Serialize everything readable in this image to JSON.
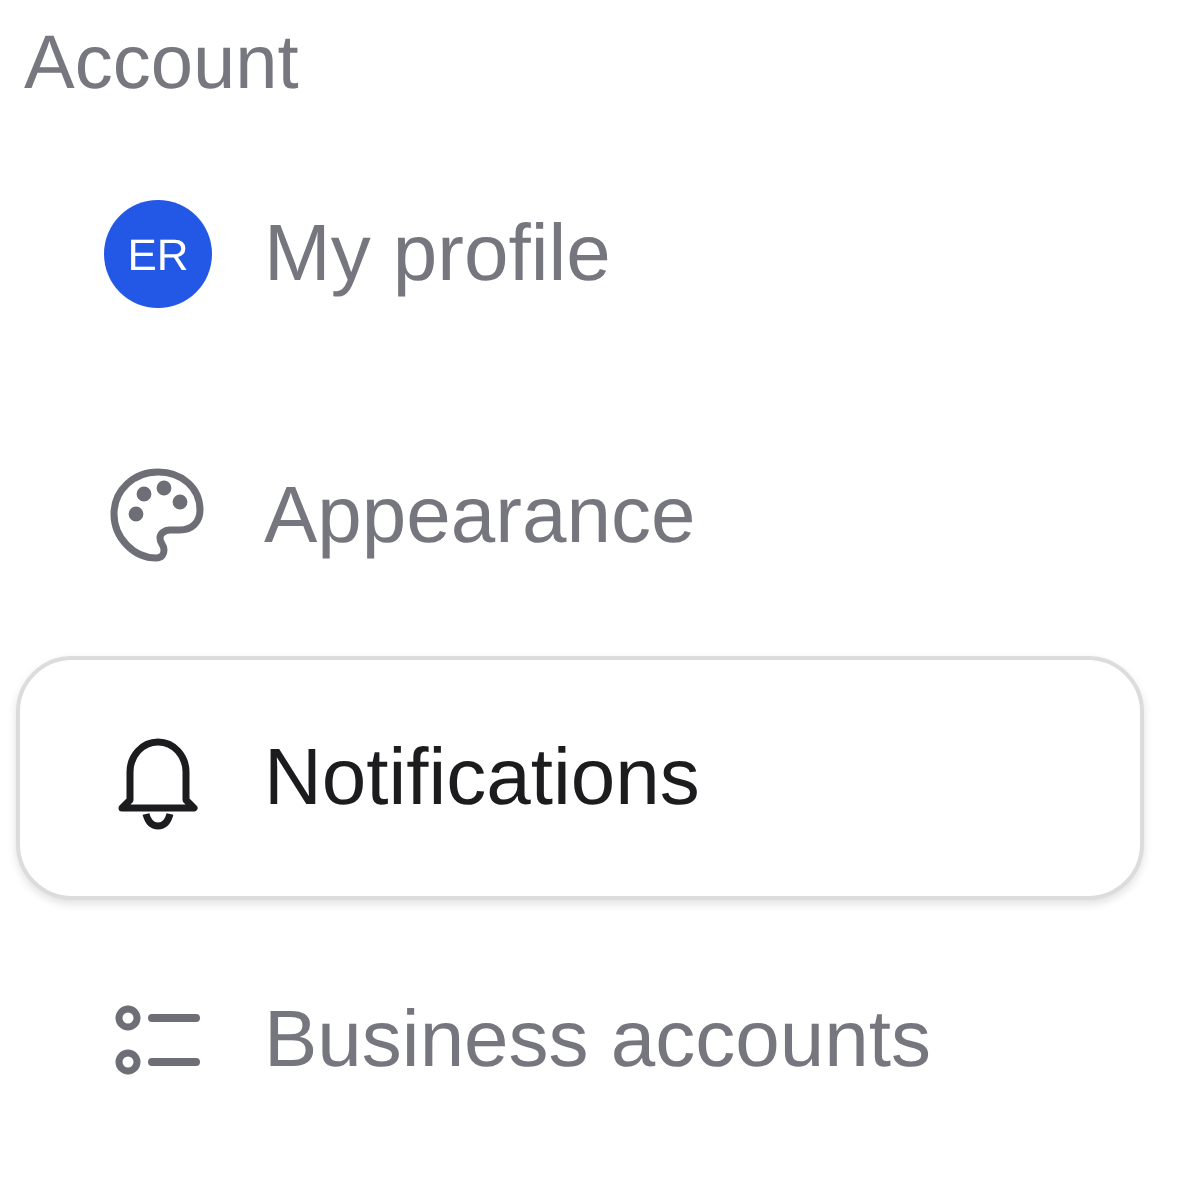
{
  "section_title": "Account",
  "items": [
    {
      "kind": "avatar",
      "initials": "ER",
      "color": "#2358e6",
      "label": "My profile",
      "selected": false
    },
    {
      "kind": "palette",
      "label": "Appearance",
      "selected": false
    },
    {
      "kind": "bell",
      "label": "Notifications",
      "selected": true
    },
    {
      "kind": "list",
      "label": "Business accounts",
      "selected": false
    }
  ]
}
